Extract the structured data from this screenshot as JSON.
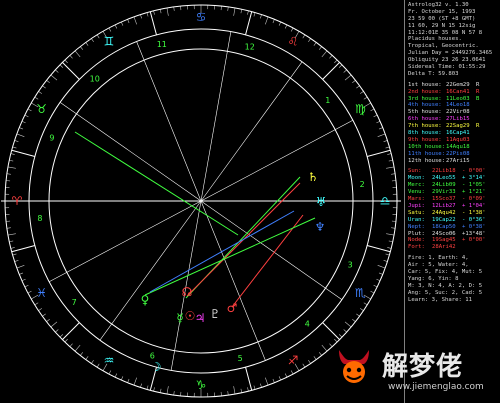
{
  "header": [
    "Astrolog32 v. 1.30",
    "Fr. October 15, 1993",
    "23 59 00 (ST +8 GMT)",
    "11 60, 29    N 15 12sig",
    "11:12:01E 35 08 N 57 8",
    "Placidus houses.",
    "Tropical, Geocentric.",
    "Julian Day = 2449276.3465",
    "Obliquity 23 26 23.0641",
    "Sidereal Time: 01:55:29",
    "Delta T:  59.803"
  ],
  "houses": [
    {
      "label": "1st house:",
      "value": "22Gem29",
      "mark": "R",
      "color": "#e0e0e0"
    },
    {
      "label": "2nd house:",
      "value": "16Can41",
      "mark": "R",
      "color": "#ff4040"
    },
    {
      "label": "3rd house:",
      "value": "11Leo03",
      "mark": "B",
      "color": "#40ff40"
    },
    {
      "label": "4th house:",
      "value": "14Leo18",
      "mark": "",
      "color": "#4080ff"
    },
    {
      "label": "5th house:",
      "value": "22Vir08",
      "mark": "",
      "color": "#e0e0e0"
    },
    {
      "label": "6th house:",
      "value": "27Lib15",
      "mark": "",
      "color": "#ff40ff"
    },
    {
      "label": "7th house:",
      "value": "22Sag29",
      "mark": "R",
      "color": "#ffff40"
    },
    {
      "label": "8th house:",
      "value": "16Cap41",
      "mark": "",
      "color": "#40ffff"
    },
    {
      "label": "9th house:",
      "value": "11Aqu03",
      "mark": "",
      "color": "#ff4040"
    },
    {
      "label": "10th house:",
      "value": "14Aqu18",
      "mark": "",
      "color": "#40ff40"
    },
    {
      "label": "11th house:",
      "value": "22Pis08",
      "mark": "",
      "color": "#4080ff"
    },
    {
      "label": "12th house:",
      "value": "27Ari15",
      "mark": "",
      "color": "#e0e0e0"
    }
  ],
  "planets": [
    {
      "name": "Sun:",
      "pos": "22Lib18",
      "lat": "- 0°00'",
      "color": "#ff4040"
    },
    {
      "name": "Moon:",
      "pos": "24Leo55",
      "lat": "+ 3°14'",
      "color": "#40ffff"
    },
    {
      "name": "Merc:",
      "pos": "24Lib09",
      "lat": "- 1°05'",
      "color": "#40ff40"
    },
    {
      "name": "Venu:",
      "pos": "29Vir33",
      "lat": "+ 1°21'",
      "color": "#40ff40"
    },
    {
      "name": "Mars:",
      "pos": "15Sco37",
      "lat": "- 0°09'",
      "color": "#ff4040"
    },
    {
      "name": "Jupi:",
      "pos": "12Lib27",
      "lat": "+ 1°04'",
      "color": "#ff40ff"
    },
    {
      "name": "Satu:",
      "pos": "24Aqu42",
      "lat": "- 1°38'",
      "color": "#ffff40"
    },
    {
      "name": "Uran:",
      "pos": "19Cap22",
      "lat": "- 0°36'",
      "color": "#40ffff"
    },
    {
      "name": "Nept:",
      "pos": "18Cap50",
      "lat": "+ 0°38'",
      "color": "#4080ff"
    },
    {
      "name": "Plut:",
      "pos": "24Sco06",
      "lat": "+13°48'",
      "color": "#e0e0e0"
    },
    {
      "name": "Node:",
      "pos": "19Sag45",
      "lat": "+ 0°00'",
      "color": "#ff4040"
    },
    {
      "name": "Fort:",
      "pos": "28Ari42",
      "lat": "",
      "color": "#ff4040"
    }
  ],
  "elements": [
    "Fire:  1, Earth: 4,",
    "Air :  5, Water: 4,",
    "Car: 5, Fix: 4, Mut: 5",
    "Yang: 6, Yin: 8",
    "M: 3, N: 4, A: 2, D: 5",
    "Ang: 5, Suc: 2, Cad: 5",
    "Learn: 3, Share: 11"
  ],
  "wheel": {
    "ring_color": "#ffffff",
    "degree_mark_color": "#c0c0c0",
    "house_numbers": [
      "11",
      "10",
      "9",
      "8",
      "7",
      "6",
      "5",
      "4",
      "3",
      "2",
      "1",
      "12"
    ],
    "signs": [
      {
        "glyph": "♈",
        "color": "#ff4040"
      },
      {
        "glyph": "♉",
        "color": "#40ff40"
      },
      {
        "glyph": "♊",
        "color": "#40ffff"
      },
      {
        "glyph": "♋",
        "color": "#4080ff"
      },
      {
        "glyph": "♌",
        "color": "#ff4040"
      },
      {
        "glyph": "♍",
        "color": "#40ff40"
      },
      {
        "glyph": "♎",
        "color": "#40ffff"
      },
      {
        "glyph": "♏",
        "color": "#4080ff"
      },
      {
        "glyph": "♐",
        "color": "#ff4040"
      },
      {
        "glyph": "♑",
        "color": "#40ff40"
      },
      {
        "glyph": "♒",
        "color": "#40ffff"
      },
      {
        "glyph": "♓",
        "color": "#4080ff"
      }
    ],
    "planet_glyphs": [
      {
        "glyph": "♄",
        "color": "#ffff40"
      },
      {
        "glyph": "♅",
        "color": "#40ffff"
      },
      {
        "glyph": "♆",
        "color": "#4080ff"
      },
      {
        "glyph": "♀",
        "color": "#40ff40"
      },
      {
        "glyph": "☊",
        "color": "#ff4040"
      },
      {
        "glyph": "♂",
        "color": "#ff4040"
      },
      {
        "glyph": "☉",
        "color": "#ff4040"
      },
      {
        "glyph": "☿",
        "color": "#40ff40"
      },
      {
        "glyph": "♃",
        "color": "#ff40ff"
      },
      {
        "glyph": "♇",
        "color": "#e0e0e0"
      },
      {
        "glyph": "☽",
        "color": "#40ffff"
      }
    ]
  },
  "watermark": {
    "title": "解梦佬",
    "url": "www.jiemenglao.com",
    "logo": "horned-demon-logo"
  }
}
